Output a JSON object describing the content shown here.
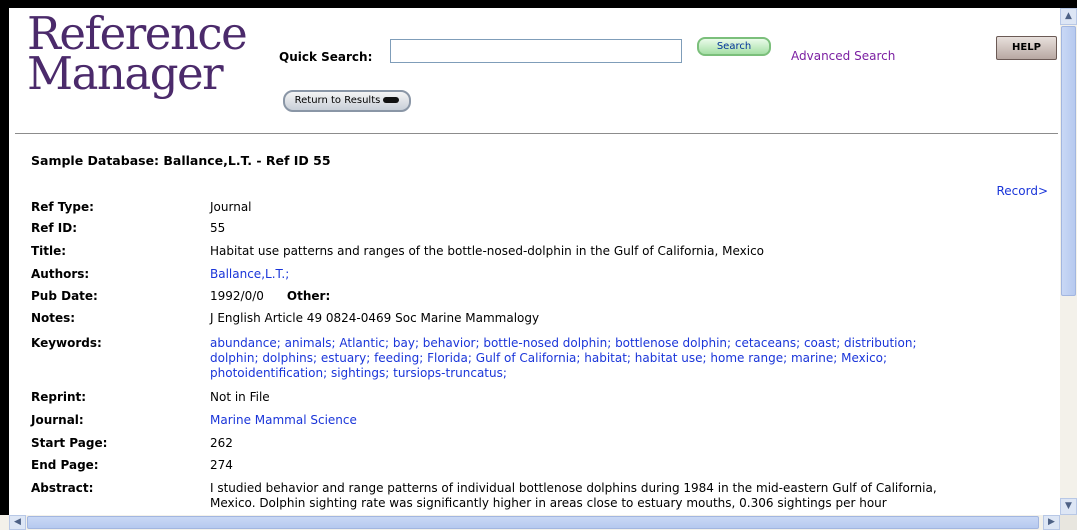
{
  "logo": {
    "line1": "Reference",
    "line2": "Manager"
  },
  "quick_search": {
    "label": "Quick Search:",
    "value": "",
    "placeholder": ""
  },
  "buttons": {
    "search": "Search",
    "help": "HELP",
    "return_to_results": "Return to Results"
  },
  "advanced_search": "Advanced Search",
  "database_title": "Sample Database: Ballance,L.T. - Ref ID 55",
  "record_link": "Record>",
  "fields": {
    "ref_type": {
      "label": "Ref Type:",
      "value": "Journal"
    },
    "ref_id": {
      "label": "Ref ID:",
      "value": "55"
    },
    "title": {
      "label": "Title:",
      "value": "Habitat use patterns and ranges of the bottle-nosed-dolphin in the Gulf of California, Mexico"
    },
    "authors": {
      "label": "Authors:",
      "value": "Ballance,L.T.;"
    },
    "pub_date": {
      "label": "Pub Date:",
      "value": "1992/0/0",
      "other_label": "Other:"
    },
    "notes": {
      "label": "Notes:",
      "value": "J English Article 49 0824-0469 Soc Marine Mammalogy"
    },
    "keywords": {
      "label": "Keywords:",
      "line1": "abundance; animals; Atlantic; bay; behavior; bottle-nosed dolphin; bottlenose dolphin; cetaceans; coast; distribution;",
      "line2": "dolphin; dolphins; estuary; feeding; Florida; Gulf of California; habitat; habitat use; home range; marine; Mexico;",
      "line3": "photoidentification; sightings; tursiops-truncatus;"
    },
    "reprint": {
      "label": "Reprint:",
      "value": "Not in File"
    },
    "journal": {
      "label": "Journal:",
      "value": "Marine Mammal Science"
    },
    "start_page": {
      "label": "Start Page:",
      "value": "262"
    },
    "end_page": {
      "label": "End Page:",
      "value": "274"
    },
    "abstract": {
      "label": "Abstract:",
      "line1": "I studied behavior and range patterns of individual bottlenose dolphins during 1984 in the mid-eastern Gulf of California,",
      "line2": "Mexico. Dolphin sighting rate was significantly higher in areas close to estuary mouths, 0.306 sightings per hour"
    }
  },
  "colors": {
    "logo": "#4b2a6b",
    "link": "#1a35d9",
    "advanced_search": "#7b1fa2"
  }
}
